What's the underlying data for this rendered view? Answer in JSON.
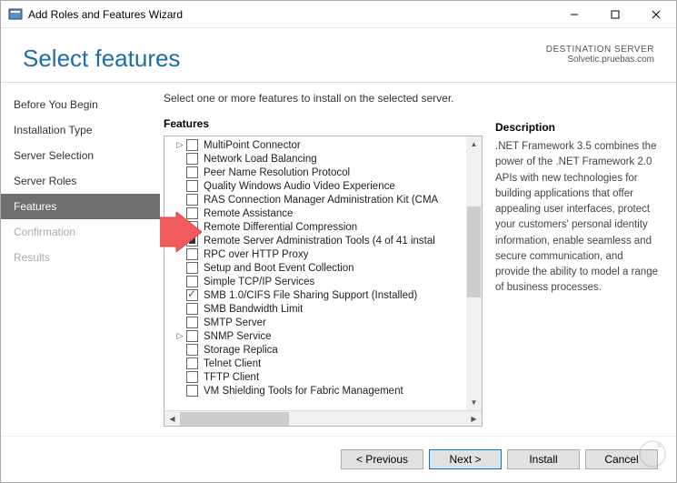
{
  "window": {
    "title": "Add Roles and Features Wizard"
  },
  "header": {
    "title": "Select features",
    "dest_label": "DESTINATION SERVER",
    "dest_value": "Solvetic.pruebas.com"
  },
  "sidebar": {
    "steps": [
      {
        "label": "Before You Begin",
        "state": "normal"
      },
      {
        "label": "Installation Type",
        "state": "normal"
      },
      {
        "label": "Server Selection",
        "state": "normal"
      },
      {
        "label": "Server Roles",
        "state": "normal"
      },
      {
        "label": "Features",
        "state": "active"
      },
      {
        "label": "Confirmation",
        "state": "disabled"
      },
      {
        "label": "Results",
        "state": "disabled"
      }
    ]
  },
  "main": {
    "instruction": "Select one or more features to install on the selected server.",
    "features_label": "Features",
    "description_label": "Description",
    "description_text": ".NET Framework 3.5 combines the power of the .NET Framework 2.0 APIs with new technologies for building applications that offer appealing user interfaces, protect your customers' personal identity information, enable seamless and secure communication, and provide the ability to model a range of business processes.",
    "features": [
      {
        "label": "MultiPoint Connector",
        "expand": true,
        "check": "none"
      },
      {
        "label": "Network Load Balancing",
        "expand": false,
        "check": "none"
      },
      {
        "label": "Peer Name Resolution Protocol",
        "expand": false,
        "check": "none"
      },
      {
        "label": "Quality Windows Audio Video Experience",
        "expand": false,
        "check": "none"
      },
      {
        "label": "RAS Connection Manager Administration Kit (CMA",
        "expand": false,
        "check": "none"
      },
      {
        "label": "Remote Assistance",
        "expand": false,
        "check": "none"
      },
      {
        "label": "Remote Differential Compression",
        "expand": false,
        "check": "none"
      },
      {
        "label": "Remote Server Administration Tools (4 of 41 instal",
        "expand": true,
        "check": "indet"
      },
      {
        "label": "RPC over HTTP Proxy",
        "expand": false,
        "check": "none"
      },
      {
        "label": "Setup and Boot Event Collection",
        "expand": false,
        "check": "none"
      },
      {
        "label": "Simple TCP/IP Services",
        "expand": false,
        "check": "none"
      },
      {
        "label": "SMB 1.0/CIFS File Sharing Support (Installed)",
        "expand": false,
        "check": "checked"
      },
      {
        "label": "SMB Bandwidth Limit",
        "expand": false,
        "check": "none"
      },
      {
        "label": "SMTP Server",
        "expand": false,
        "check": "none"
      },
      {
        "label": "SNMP Service",
        "expand": true,
        "check": "none"
      },
      {
        "label": "Storage Replica",
        "expand": false,
        "check": "none"
      },
      {
        "label": "Telnet Client",
        "expand": false,
        "check": "none"
      },
      {
        "label": "TFTP Client",
        "expand": false,
        "check": "none"
      },
      {
        "label": "VM Shielding Tools for Fabric Management",
        "expand": false,
        "check": "none"
      }
    ]
  },
  "footer": {
    "previous": "< Previous",
    "next": "Next >",
    "install": "Install",
    "cancel": "Cancel"
  }
}
